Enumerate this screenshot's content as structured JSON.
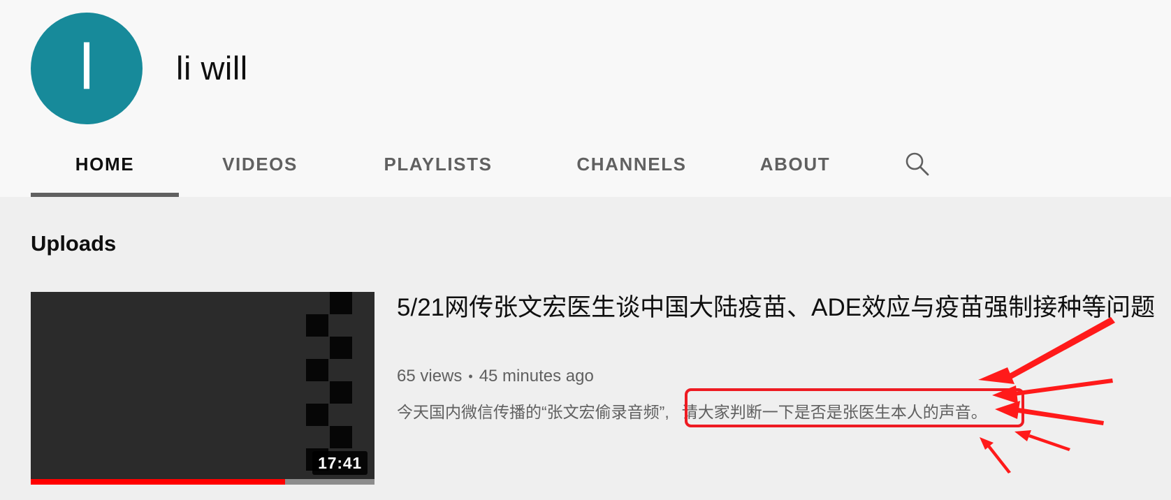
{
  "channel": {
    "avatar_letter": "l",
    "avatar_color": "#178a9a",
    "name": "li will"
  },
  "tabs": [
    {
      "label": "HOME",
      "active": true
    },
    {
      "label": "VIDEOS",
      "active": false
    },
    {
      "label": "PLAYLISTS",
      "active": false
    },
    {
      "label": "CHANNELS",
      "active": false
    },
    {
      "label": "ABOUT",
      "active": false
    }
  ],
  "search_icon": "search-icon",
  "uploads": {
    "title": "Uploads",
    "videos": [
      {
        "title": "5/21网传张文宏医生谈中国大陆疫苗、ADE效应与疫苗强制接种等问题",
        "views": "65 views",
        "separator": "•",
        "age": "45 minutes ago",
        "description_prefix": "今天国内微信传播的“张文宏偷录音频”,",
        "description_highlight": "请大家判断一下是否是张医生本人的声音。",
        "duration": "17:41",
        "watch_progress": 0.74
      }
    ]
  },
  "annotation": {
    "highlight_color": "#ee1b22",
    "arrow_color": "#ff1a1a"
  }
}
